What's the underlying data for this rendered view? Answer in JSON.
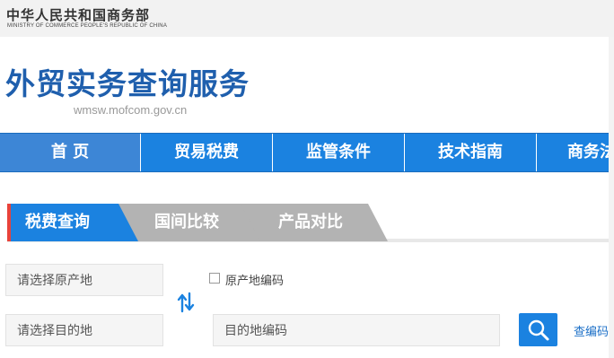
{
  "header": {
    "ministry_cn": "中华人民共和国商务部",
    "ministry_en": "MINISTRY OF COMMERCE PEOPLE'S REPUBLIC OF CHINA",
    "site_title": "外贸实务查询服务",
    "site_url": "wmsw.mofcom.gov.cn"
  },
  "nav": {
    "items": [
      {
        "label": "首  页"
      },
      {
        "label": "贸易税费"
      },
      {
        "label": "监管条件"
      },
      {
        "label": "技术指南"
      },
      {
        "label": "商务法"
      }
    ]
  },
  "tabs": [
    {
      "label": "税费查询",
      "active": true
    },
    {
      "label": "国间比较",
      "active": false
    },
    {
      "label": "产品对比",
      "active": false
    }
  ],
  "form": {
    "origin_placeholder": "请选择原产地",
    "origin_code_checkbox_label": "原产地编码",
    "dest_placeholder": "请选择目的地",
    "dest_code_placeholder": "目的地编码",
    "lookup_link": "查编码"
  },
  "icons": {
    "swap": "swap-arrows-icon",
    "search": "magnifier-icon"
  },
  "colors": {
    "brand_blue": "#1b82e0",
    "title_blue": "#1f5fad",
    "tab_inactive": "#b3b3b3",
    "tab_accent": "#e8433b"
  }
}
